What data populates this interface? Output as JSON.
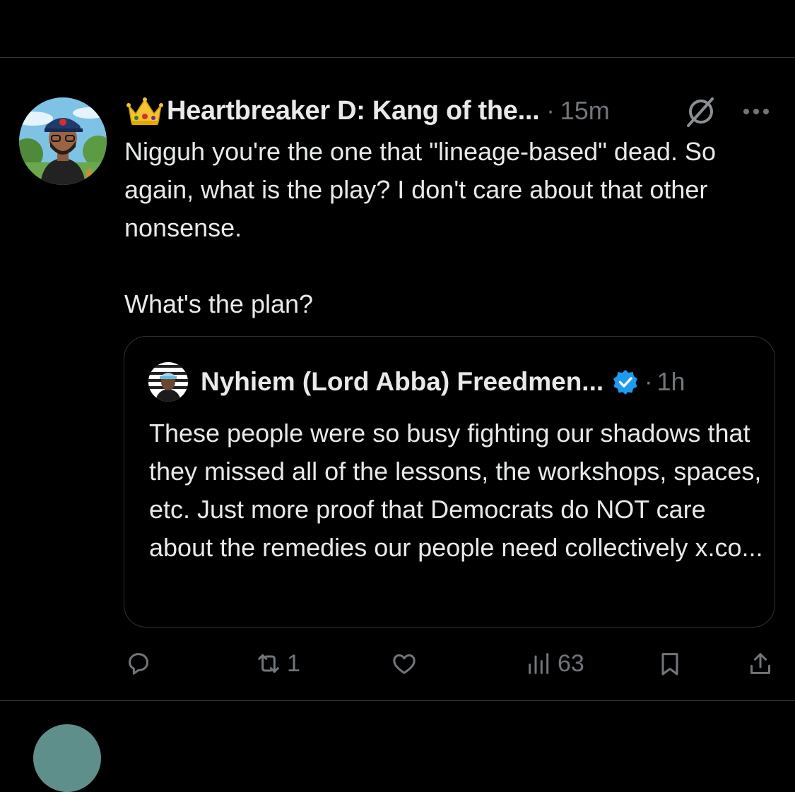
{
  "tweet": {
    "author_name": "Heartbreaker D: Kang of the...",
    "separator": "·",
    "timestamp": "15m",
    "body_paragraphs": [
      "Nigguh you're the one that \"lineage-based\" dead. So again, what is the play? I don't care about that other nonsense.",
      "What's the plan?"
    ],
    "quote": {
      "author_name": "Nyhiem (Lord Abba) Freedmen...",
      "separator": "·",
      "timestamp": "1h",
      "body": "These people were so busy fighting our shadows that they missed all of the lessons, the workshops, spaces, etc. Just more proof that Democrats do NOT care about the remedies our people need collectively x.co..."
    },
    "actions": {
      "reply_count": "",
      "repost_count": "1",
      "like_count": "",
      "views_count": "63"
    }
  },
  "colors": {
    "background": "#000000",
    "text": "#e7e9ea",
    "muted": "#71767b",
    "divider": "#2f3336",
    "verified": "#1d9bf0"
  },
  "icons": [
    "crown-icon",
    "grok-icon",
    "more-icon",
    "verified-icon",
    "reply-icon",
    "repost-icon",
    "like-icon",
    "views-icon",
    "bookmark-icon",
    "share-icon"
  ]
}
